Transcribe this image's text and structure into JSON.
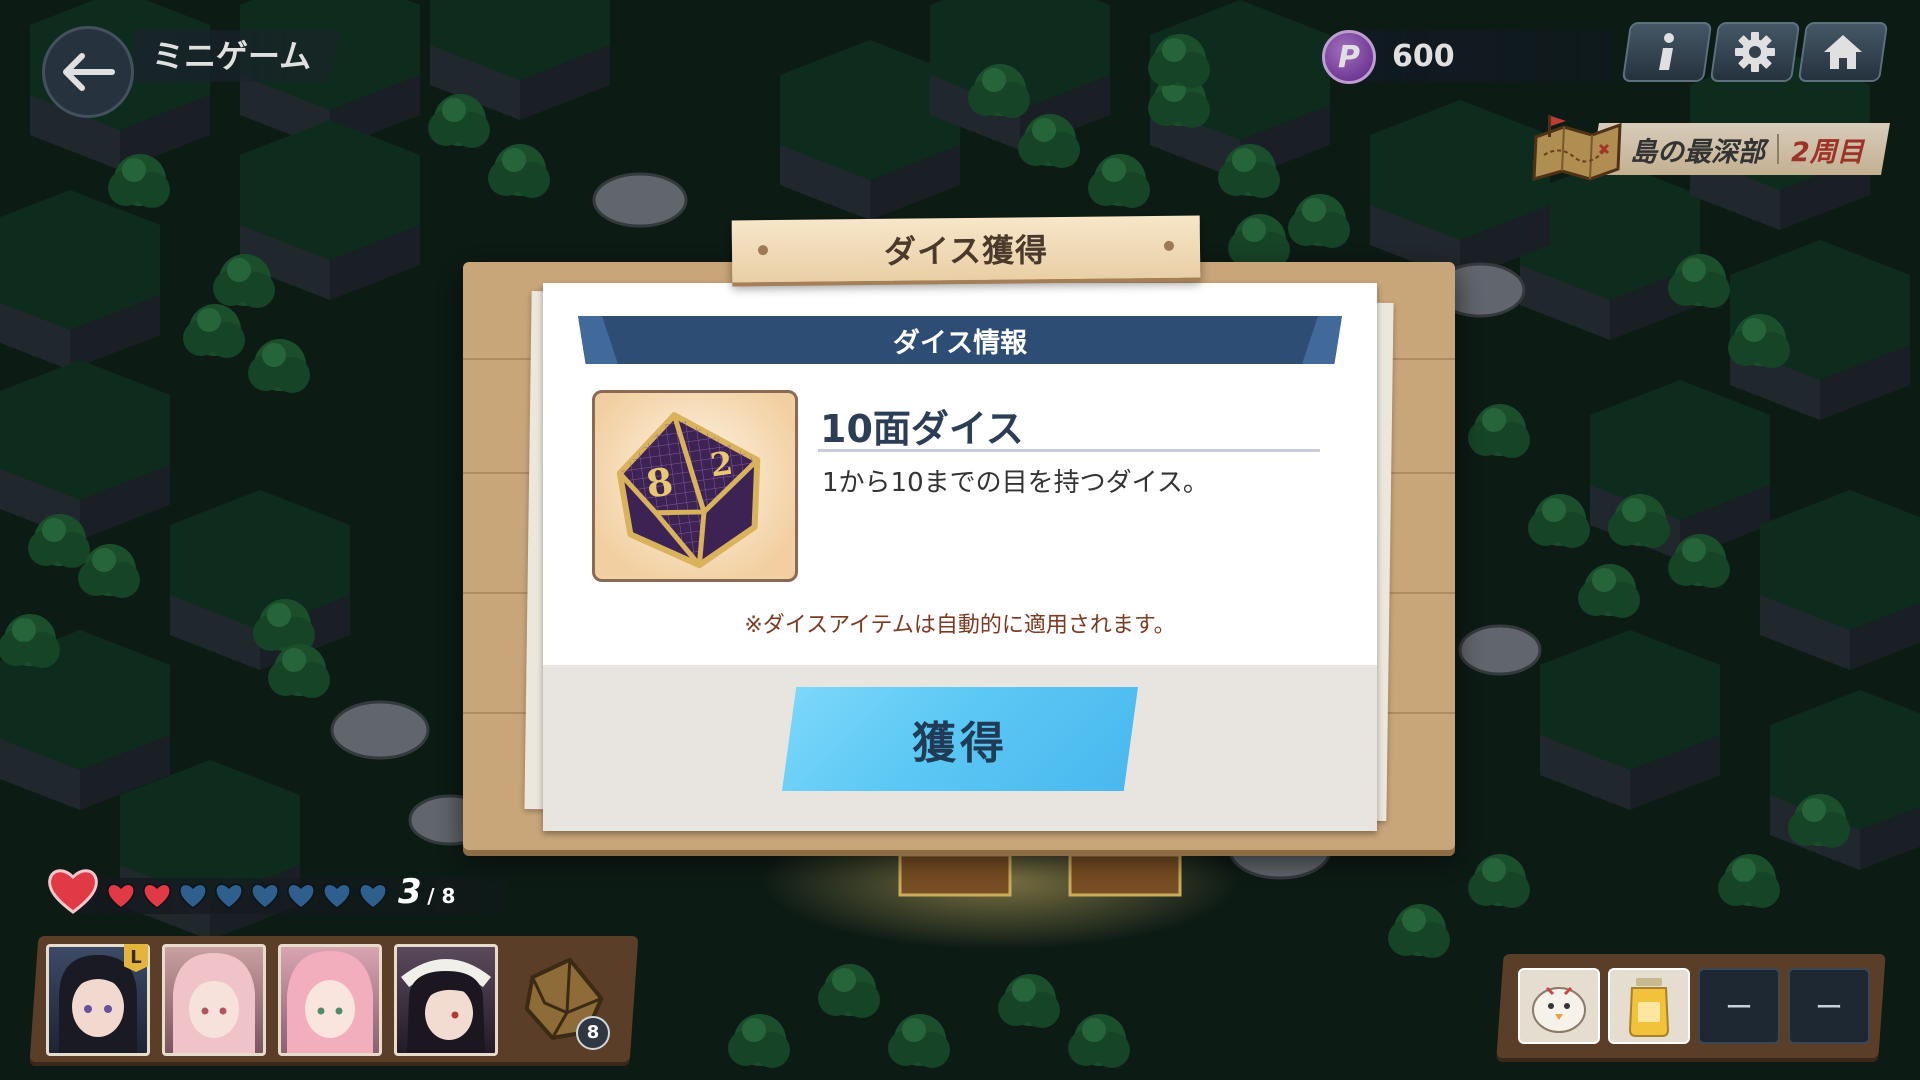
{
  "header": {
    "title": "ミニゲーム",
    "points": "600",
    "points_icon_letter": "P"
  },
  "stage": {
    "name": "島の最深部",
    "round": "2周目"
  },
  "dialog": {
    "title": "ダイス獲得",
    "section_title": "ダイス情報",
    "item_name": "10面ダイス",
    "item_description": "1から10までの目を持つダイス。",
    "dice_faces": [
      "8",
      "2"
    ],
    "notice": "※ダイスアイテムは自動的に適用されます。",
    "button_label": "獲得"
  },
  "status": {
    "hp_current": "3",
    "hp_max": "/ 8",
    "hearts_filled": 3,
    "hearts_total": 9,
    "leader_badge": "L",
    "dice_count": "8"
  },
  "items": {
    "empty_label": "ー"
  },
  "colors": {
    "accent_blue": "#5bc8f4",
    "section_bar": "#2d4d74",
    "heart_red": "#e23a44",
    "heart_empty": "#2f5f8d",
    "points_purple": "#8e4cbf",
    "round_red": "#b23a2e"
  },
  "icons": {
    "back": "arrow-left-icon",
    "info": "info-icon",
    "settings": "gear-icon",
    "home": "home-icon",
    "map": "treasure-map-icon",
    "dice": "d10-dice-icon"
  }
}
